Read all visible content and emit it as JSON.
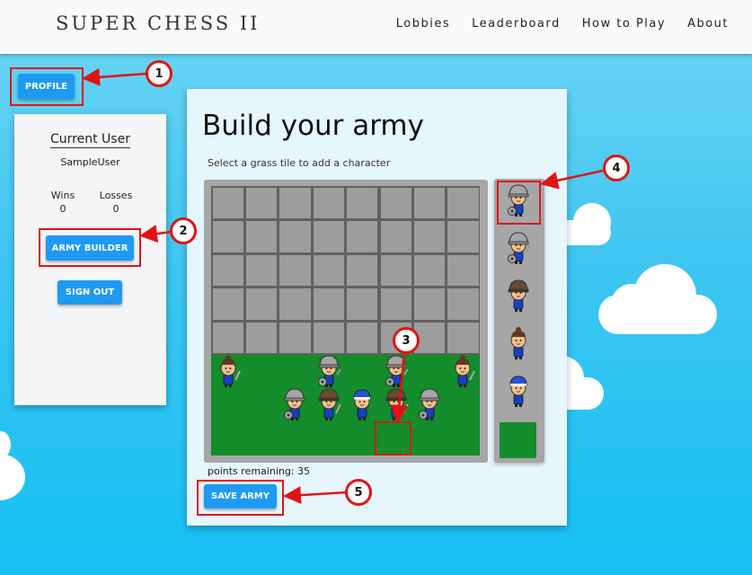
{
  "navbar": {
    "brand": "SUPER CHESS II",
    "links": [
      "Lobbies",
      "Leaderboard",
      "How to Play",
      "About"
    ]
  },
  "profile_button": "PROFILE",
  "user_card": {
    "title": "Current User",
    "username": "SampleUser",
    "wins_label": "Wins",
    "wins": "0",
    "losses_label": "Losses",
    "losses": "0",
    "army_builder_button": "ARMY BUILDER",
    "sign_out_button": "SIGN OUT"
  },
  "army_builder": {
    "title": "Build your army",
    "subtitle": "Select a grass tile to add a character",
    "points_remaining": "points remaining: 35",
    "save_button": "SAVE ARMY",
    "board": {
      "columns": 8,
      "stone_rows": 5,
      "grass_rows": 3
    },
    "placed_characters": [
      {
        "row": 5,
        "col": 0,
        "type": "topknot-swordsman"
      },
      {
        "row": 5,
        "col": 3,
        "type": "helmet-shield-heavy"
      },
      {
        "row": 5,
        "col": 5,
        "type": "helmet-shield-heavy"
      },
      {
        "row": 5,
        "col": 7,
        "type": "topknot-swordsman"
      },
      {
        "row": 6,
        "col": 2,
        "type": "helmet-shield"
      },
      {
        "row": 6,
        "col": 3,
        "type": "leather-helmet-sword"
      },
      {
        "row": 6,
        "col": 4,
        "type": "blue-cap"
      },
      {
        "row": 6,
        "col": 5,
        "type": "leather-helmet-sword"
      },
      {
        "row": 6,
        "col": 6,
        "type": "helmet-shield"
      }
    ],
    "selected_tile": {
      "row": 7,
      "col": 5
    },
    "palette": [
      "helmet-shield",
      "helmet-shield-heavy",
      "leather-helmet-sword",
      "topknot-swordsman",
      "blue-cap",
      "empty-grass"
    ]
  },
  "annotations": [
    "1",
    "2",
    "3",
    "4",
    "5"
  ],
  "colors": {
    "accent": "#1e9af2",
    "highlight": "#e01414",
    "grass": "#138c2b",
    "stone": "#9d9d9d"
  }
}
